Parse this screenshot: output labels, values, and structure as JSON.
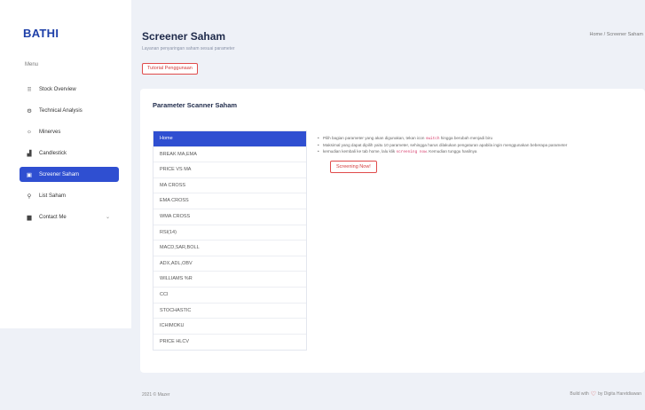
{
  "brand": "BATHI",
  "sidebar": {
    "menu_label": "Menu",
    "items": [
      {
        "label": "Stock Overview",
        "icon": "grid-icon",
        "glyph": "⠿"
      },
      {
        "label": "Technical Analysis",
        "icon": "settings-icon",
        "glyph": "⚙"
      },
      {
        "label": "Minerves",
        "icon": "sun-icon",
        "glyph": "☼"
      },
      {
        "label": "Candlestick",
        "icon": "chart-icon",
        "glyph": "▟"
      },
      {
        "label": "Screener Saham",
        "icon": "screen-icon",
        "glyph": "▣"
      },
      {
        "label": "List Saham",
        "icon": "pin-icon",
        "glyph": "⚲"
      },
      {
        "label": "Contact Me",
        "icon": "briefcase-icon",
        "glyph": "▆"
      }
    ]
  },
  "header": {
    "title": "Screener Saham",
    "subtitle": "Layanan penyaringan saham sesuai parameter",
    "breadcrumb": "Home / Screener Saham",
    "tutorial_label": "Tutorial Penggunaan"
  },
  "card": {
    "title": "Parameter Scanner Saham",
    "params": [
      "Home",
      "BREAK MA,EMA",
      "PRICE VS MA",
      "MA CROSS",
      "EMA CROSS",
      "WMA CROSS",
      "RSI(14)",
      "MACD,SAR,BOLL",
      "ADX,ADL,OBV",
      "WILLIAMS %R",
      "CCI",
      "STOCHASTIC",
      "ICHIMOKU",
      "PRICE HLCV"
    ],
    "info": {
      "line1_a": "Pilih bagian parameter yang akan digunakan, tekan icon ",
      "line1_code": "switch",
      "line1_b": " hingga berubah menjadi biru",
      "line2": "Maksimal yang dapat dipilih yaitu 10 parameter, sehingga harus dilakukan pengaturan apabila ingin menggunakan beberapa parameter",
      "line3_a": "kemudian kembali ke tab home, lalu klik ",
      "line3_code": "screening now",
      "line3_b": ". Kemudian tunggu hasilnya"
    },
    "screen_label": "Screening Now!"
  },
  "footer": {
    "left": "2021 © Mazer",
    "right_a": "Build with",
    "right_b": "by Digita Haretdiawan"
  }
}
